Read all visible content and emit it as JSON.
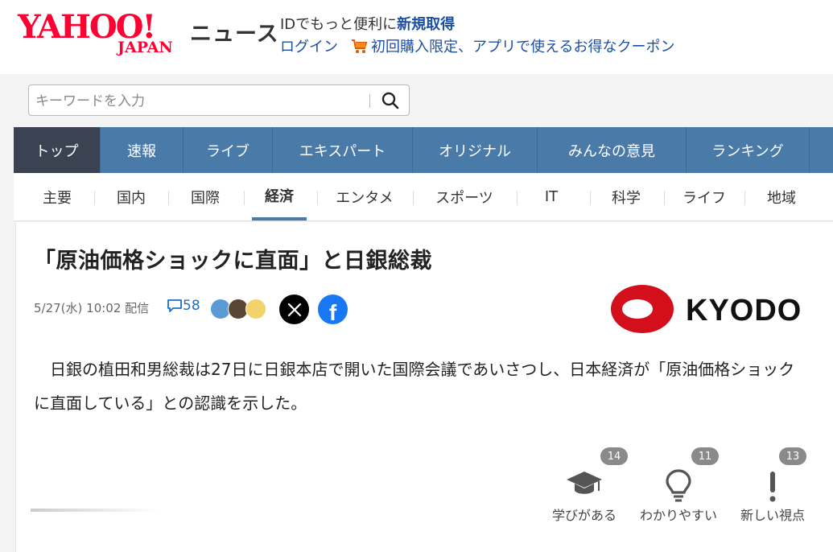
{
  "header": {
    "logo_yahoo": "YAHOO!",
    "logo_japan": "JAPAN",
    "service_name": "ニュース",
    "promo_text": "IDでもっと便利に",
    "promo_link": "新規取得",
    "login_label": "ログイン",
    "coupon_text": "初回購入限定、アプリで使えるお得なクーポン"
  },
  "search": {
    "placeholder": "キーワードを入力"
  },
  "main_nav": [
    {
      "label": "トップ",
      "active": true
    },
    {
      "label": "速報"
    },
    {
      "label": "ライブ"
    },
    {
      "label": "エキスパート"
    },
    {
      "label": "オリジナル"
    },
    {
      "label": "みんなの意見"
    },
    {
      "label": "ランキング"
    }
  ],
  "sub_nav": [
    {
      "label": "主要"
    },
    {
      "label": "国内"
    },
    {
      "label": "国際"
    },
    {
      "label": "経済",
      "active": true
    },
    {
      "label": "エンタメ"
    },
    {
      "label": "スポーツ"
    },
    {
      "label": "IT"
    },
    {
      "label": "科学"
    },
    {
      "label": "ライフ"
    },
    {
      "label": "地域"
    }
  ],
  "article": {
    "title": "「原油価格ショックに直面」と日銀総裁",
    "datetime": "5/27(水) 10:02 配信",
    "comment_count": "58",
    "source_logo": "KYODO",
    "body": "日銀の植田和男総裁は27日に日銀本店で開いた国際会議であいさつし、日本経済が「原油価格ショックに直面している」との認識を示した。"
  },
  "reactions": [
    {
      "label": "学びがある",
      "count": "14",
      "icon": "graduation-cap-icon"
    },
    {
      "label": "わかりやすい",
      "count": "11",
      "icon": "lightbulb-icon"
    },
    {
      "label": "新しい視点",
      "count": "13",
      "icon": "exclamation-icon"
    }
  ],
  "colors": {
    "brand_red": "#ff0033",
    "nav_blue": "#4a7ba8",
    "nav_active": "#3b4251",
    "link_blue": "#1b4fa3",
    "facebook": "#1877f2"
  }
}
